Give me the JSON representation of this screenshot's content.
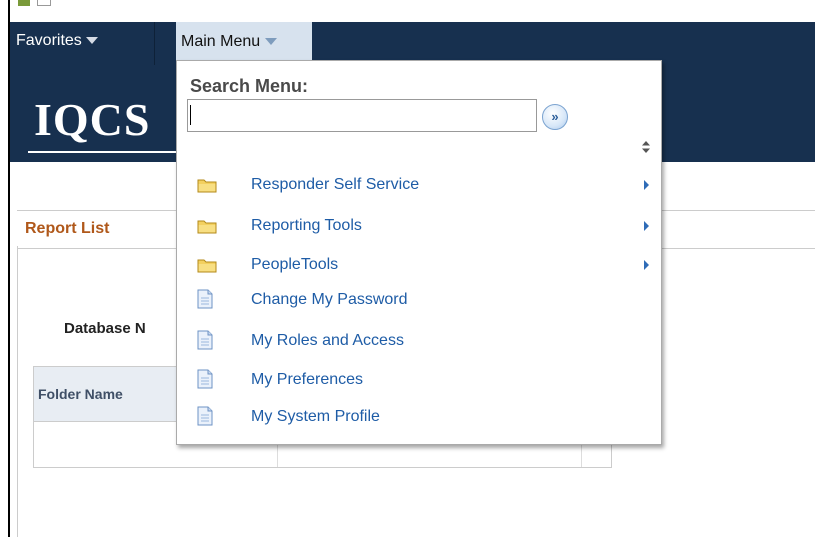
{
  "navbar": {
    "favorites_label": "Favorites",
    "main_menu_label": "Main Menu"
  },
  "banner": {
    "logo_text": "IQCS"
  },
  "report_list": {
    "title": "Report List",
    "database_label": "Database N",
    "folder_column": "Folder Name"
  },
  "menu": {
    "search_title": "Search Menu:",
    "search_value": "",
    "go_icon": "double-chevron-right-icon",
    "items": [
      {
        "label": "Responder Self Service",
        "icon": "folder-icon",
        "submenu": true
      },
      {
        "label": "Reporting Tools",
        "icon": "folder-icon",
        "submenu": true
      },
      {
        "label": "PeopleTools",
        "icon": "folder-icon",
        "submenu": true
      },
      {
        "label": "Change My Password",
        "icon": "document-icon",
        "submenu": false
      },
      {
        "label": "My Roles and Access",
        "icon": "document-icon",
        "submenu": false
      },
      {
        "label": "My Preferences",
        "icon": "document-icon",
        "submenu": false
      },
      {
        "label": "My System Profile",
        "icon": "document-icon",
        "submenu": false
      }
    ]
  },
  "colors": {
    "navbar": "#17304f",
    "menu_tab": "#d7e2ee",
    "link": "#1e5ca6",
    "report_title": "#b0581a"
  }
}
